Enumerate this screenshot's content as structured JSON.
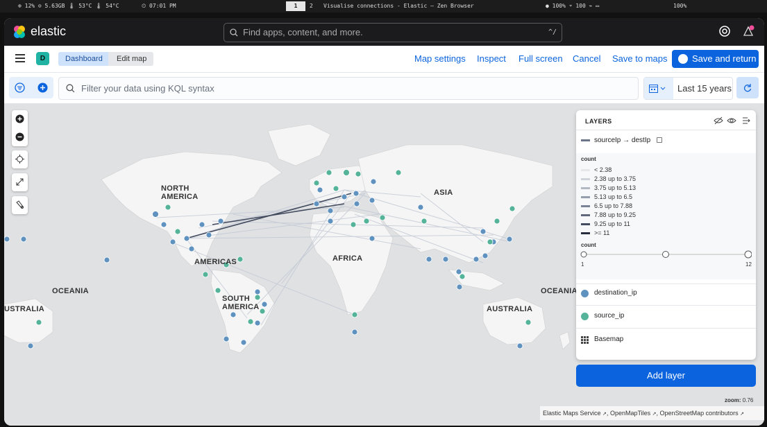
{
  "system_bar": {
    "stats": "⊕ 12%  ⊙ 5.63GB  🌡 53°C  🌡 54°C",
    "time": "⏲ 07:01 PM",
    "workspace_active": "1",
    "workspace_other": "2",
    "window_title": "Visualise connections - Elastic — Zen Browser",
    "right_status": "● 100%  ⌔ 100  ⌁  ▭",
    "right_status2": "100%"
  },
  "header": {
    "brand": "elastic",
    "search_placeholder": "Find apps, content, and more.",
    "search_shortcut": "^/"
  },
  "nav": {
    "space_initial": "D",
    "breadcrumbs": [
      "Dashboard",
      "Edit map"
    ],
    "links": [
      "Map settings",
      "Inspect",
      "Full screen",
      "Cancel",
      "Save to maps"
    ],
    "save_return": "Save and return"
  },
  "query": {
    "placeholder": "Filter your data using KQL syntax",
    "time_range": "Last 15 years"
  },
  "map": {
    "labels": {
      "north_america": "NORTH\nAMERICA",
      "asia": "ASIA",
      "americas": "AMERICAS",
      "africa": "AFRICA",
      "oceania_left": "OCEANIA",
      "oceania_right": "OCEANIA",
      "australia_left": "USTRALIA",
      "australia_right": "AUSTRALIA",
      "south_america": "SOUTH\nAMERICA"
    },
    "zoom_label": "zoom:",
    "zoom_value": "0.76",
    "attribution": [
      "Elastic Maps Service",
      "OpenMapTiles",
      "OpenStreetMap contributors"
    ]
  },
  "layers_panel": {
    "title": "LAYERS",
    "connection_layer": "sourceIp → destIp",
    "legend_title": "count",
    "legend_items": [
      "< 2.38",
      "2.38 up to 3.75",
      "3.75 up to 5.13",
      "5.13 up to 6.5",
      "6.5 up to 7.88",
      "7.88 up to 9.25",
      "9.25 up to 11",
      ">= 11"
    ],
    "legend_colors": [
      "#e6e8ec",
      "#cfd3da",
      "#b3b9c3",
      "#969ead",
      "#7a8396",
      "#5e677c",
      "#434b5e",
      "#272d3c"
    ],
    "size_title": "count",
    "size_min": "1",
    "size_max": "12",
    "layers": [
      {
        "name": "destination_ip",
        "color": "#6092c0"
      },
      {
        "name": "source_ip",
        "color": "#54b399"
      },
      {
        "name": "Basemap",
        "icon": "grid-icon"
      }
    ],
    "add_layer": "Add layer"
  }
}
